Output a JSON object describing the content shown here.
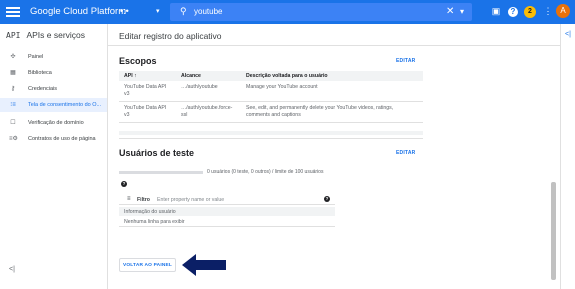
{
  "topbar": {
    "brand": "Google Cloud Platform",
    "project_icon": "•:•",
    "project_caret": "▾",
    "search_value": "youtube",
    "search_icon": "search-icon",
    "clear_glyph": "✕",
    "expand_glyph": "▾",
    "help_glyph": "?",
    "notifications_count": "2",
    "more_glyph": "⋮",
    "avatar_letter": "A",
    "colors": {
      "bar": "#1a73e8",
      "search": "#3c82f5",
      "avatar": "#e8710a",
      "badge": "#fbbc04"
    }
  },
  "sidebar": {
    "api_label": "API",
    "title": "APIs e serviços",
    "items": [
      {
        "label": "Painel",
        "icon": "✣",
        "active": false
      },
      {
        "label": "Biblioteca",
        "icon": "▦",
        "active": false
      },
      {
        "label": "Credenciais",
        "icon": "⚷",
        "active": false
      },
      {
        "label": "Tela de consentimento do O...",
        "icon": "⁝≡",
        "active": true
      },
      {
        "label": "Verificação de domínio",
        "icon": "☐",
        "active": false
      },
      {
        "label": "Contratos de uso de página",
        "icon": "≡⚙",
        "active": false
      }
    ],
    "collapse_glyph": "<|"
  },
  "main": {
    "title": "Editar registro do aplicativo",
    "scopes": {
      "title": "Escopos",
      "edit_label": "EDITAR",
      "columns": [
        "API",
        "Alcance",
        "Descrição voltada para o usuário"
      ],
      "sort_glyph": "↑",
      "rows": [
        [
          "YouTube Data API v3",
          "…/auth/youtube",
          "Manage your YouTube account"
        ],
        [
          "YouTube Data API v3",
          "…/auth/youtube.force-ssl",
          "See, edit, and permanently delete your YouTube videos, ratings, comments and captions"
        ]
      ]
    },
    "test_users": {
      "title": "Usuários de teste",
      "edit_label": "EDITAR",
      "progress_fraction": 0,
      "progress_text": "0 usuários (0 teste, 0 outros) / limite de 100 usuários",
      "help_glyph": "?",
      "filter_icon": "≡",
      "filter_label": "Filtro",
      "filter_placeholder": "Enter property name or value",
      "column": "Informação do usuário",
      "empty_text": "Nenhuma linha para exibir"
    },
    "back_button": "VOLTAR AO PAINEL"
  },
  "right_strip": {
    "glyph": "<|"
  }
}
